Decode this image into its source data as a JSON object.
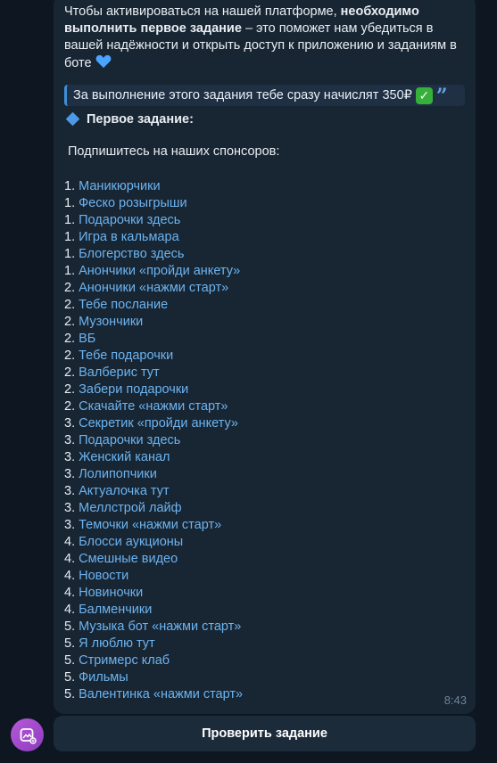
{
  "message": {
    "intro_part1": "Чтобы активироваться на нашей платформе, ",
    "intro_bold": "необходимо выполнить первое задание",
    "intro_part2": " – это поможет нам убедиться в вашей надёжности и открыть доступ к приложению и заданиям в боте",
    "quote_text": "За выполнение этого задания тебе сразу начислят 350₽",
    "task_title": "Первое задание:",
    "subscribe_text": "Подпишитесь на наших спонсоров:",
    "time": "8:43",
    "list": [
      {
        "num": "1. ",
        "label": "Маникюрчики"
      },
      {
        "num": "1. ",
        "label": "Феско розыгрыши"
      },
      {
        "num": "1. ",
        "label": "Подарочки здесь"
      },
      {
        "num": "1. ",
        "label": "Игра в кальмара"
      },
      {
        "num": "1. ",
        "label": "Блогерство здесь"
      },
      {
        "num": "1. ",
        "label": "Анончики «пройди анкету»"
      },
      {
        "num": "2. ",
        "label": "Анончики «нажми старт»"
      },
      {
        "num": "2. ",
        "label": "Тебе послание"
      },
      {
        "num": "2. ",
        "label": "Музончики"
      },
      {
        "num": "2.",
        "label": "ВБ"
      },
      {
        "num": "2. ",
        "label": "Тебе подарочки"
      },
      {
        "num": "2. ",
        "label": "Валберис тут"
      },
      {
        "num": "2. ",
        "label": "Забери подарочки"
      },
      {
        "num": "2. ",
        "label": "Скачайте «нажми старт»"
      },
      {
        "num": "3. ",
        "label": "Секретик «пройди анкету»"
      },
      {
        "num": "3. ",
        "label": "Подарочки здесь"
      },
      {
        "num": "3. ",
        "label": "Женский канал"
      },
      {
        "num": "3. ",
        "label": "Лолипопчики"
      },
      {
        "num": "3. ",
        "label": "Актуалочка тут"
      },
      {
        "num": "3. ",
        "label": "Меллстрой лайф"
      },
      {
        "num": "3. ",
        "label": "Темочки «нажми старт»"
      },
      {
        "num": "4. ",
        "label": "Блосси аукционы"
      },
      {
        "num": "4. ",
        "label": "Смешные видео"
      },
      {
        "num": "4.",
        "label": "Новости"
      },
      {
        "num": "4. ",
        "label": "Новиночки"
      },
      {
        "num": "4. ",
        "label": "Балменчики"
      },
      {
        "num": "5. ",
        "label": "Музыка бот «нажми старт»"
      },
      {
        "num": "5. ",
        "label": "Я люблю тут"
      },
      {
        "num": "5. ",
        "label": "Стримерс клаб"
      },
      {
        "num": "5.",
        "label": "Фильмы"
      },
      {
        "num": "5. ",
        "label": "Валентинка «нажми старт»"
      }
    ]
  },
  "button": {
    "label": "Проверить задание"
  },
  "icons": {
    "heart": "blue-heart-icon",
    "check": "check-mark-icon",
    "quote": "quote-icon",
    "diamond": "blue-diamond-icon",
    "avatar": "bot-avatar-icon"
  },
  "colors": {
    "background": "#0e1621",
    "bubble": "#182533",
    "link": "#6cb4f0",
    "accent": "#3e8fd6"
  }
}
